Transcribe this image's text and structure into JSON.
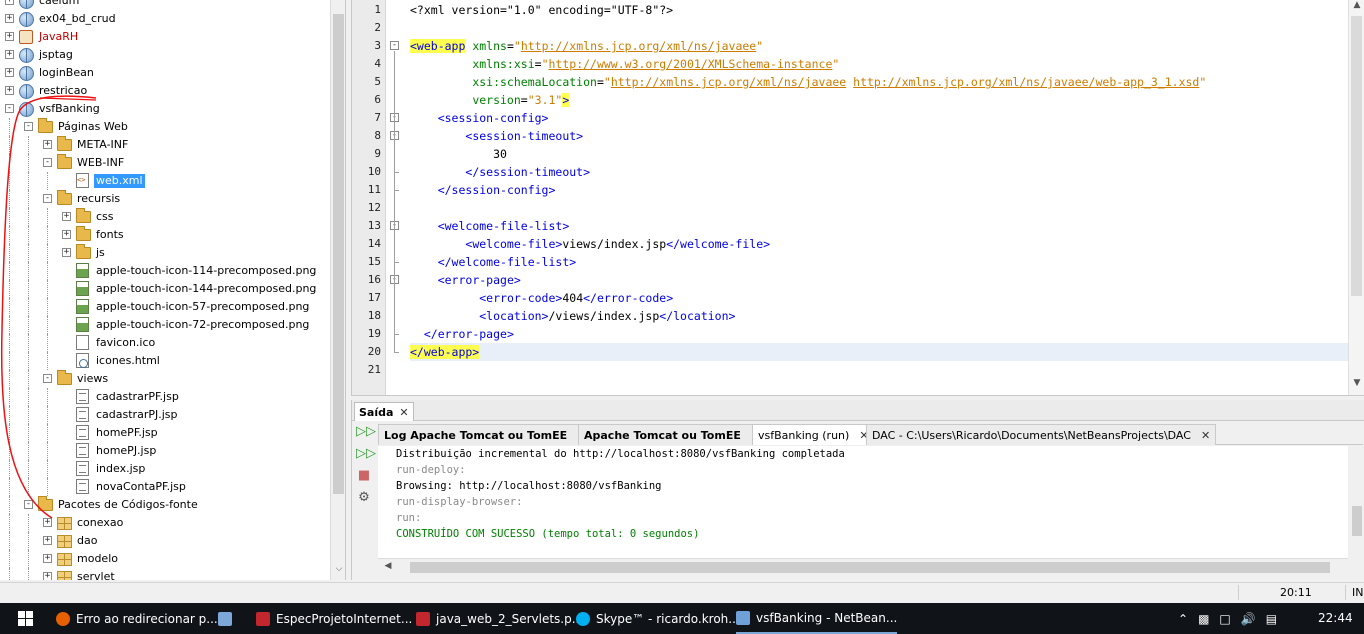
{
  "tree": {
    "items": [
      {
        "label": "caelum",
        "icon": "globe-icon",
        "depth": 0,
        "toggle": "+",
        "style": ""
      },
      {
        "label": "ex04_bd_crud",
        "icon": "globe-icon",
        "depth": 0,
        "toggle": "+",
        "style": ""
      },
      {
        "label": "JavaRH",
        "icon": "java-project-icon",
        "depth": 0,
        "toggle": "+",
        "style": "red"
      },
      {
        "label": "jsptag",
        "icon": "globe-icon",
        "depth": 0,
        "toggle": "+",
        "style": ""
      },
      {
        "label": "loginBean",
        "icon": "globe-icon",
        "depth": 0,
        "toggle": "+",
        "style": ""
      },
      {
        "label": "restricao",
        "icon": "globe-icon",
        "depth": 0,
        "toggle": "+",
        "style": ""
      },
      {
        "label": "vsfBanking",
        "icon": "globe-icon",
        "depth": 0,
        "toggle": "-",
        "style": ""
      },
      {
        "label": "Páginas Web",
        "icon": "folder-icon",
        "depth": 1,
        "toggle": "-",
        "style": ""
      },
      {
        "label": "META-INF",
        "icon": "folder-icon",
        "depth": 2,
        "toggle": "+",
        "style": ""
      },
      {
        "label": "WEB-INF",
        "icon": "folder-icon",
        "depth": 2,
        "toggle": "-",
        "style": ""
      },
      {
        "label": "web.xml",
        "icon": "xml-file-icon",
        "depth": 3,
        "toggle": "",
        "style": "selected"
      },
      {
        "label": "recursis",
        "icon": "folder-icon",
        "depth": 2,
        "toggle": "-",
        "style": ""
      },
      {
        "label": "css",
        "icon": "folder-icon",
        "depth": 3,
        "toggle": "+",
        "style": ""
      },
      {
        "label": "fonts",
        "icon": "folder-icon",
        "depth": 3,
        "toggle": "+",
        "style": ""
      },
      {
        "label": "js",
        "icon": "folder-icon",
        "depth": 3,
        "toggle": "+",
        "style": ""
      },
      {
        "label": "apple-touch-icon-114-precomposed.png",
        "icon": "png-file-icon",
        "depth": 3,
        "toggle": "",
        "style": ""
      },
      {
        "label": "apple-touch-icon-144-precomposed.png",
        "icon": "png-file-icon",
        "depth": 3,
        "toggle": "",
        "style": ""
      },
      {
        "label": "apple-touch-icon-57-precomposed.png",
        "icon": "png-file-icon",
        "depth": 3,
        "toggle": "",
        "style": ""
      },
      {
        "label": "apple-touch-icon-72-precomposed.png",
        "icon": "png-file-icon",
        "depth": 3,
        "toggle": "",
        "style": ""
      },
      {
        "label": "favicon.ico",
        "icon": "ico-file-icon",
        "depth": 3,
        "toggle": "",
        "style": ""
      },
      {
        "label": "icones.html",
        "icon": "html-file-icon",
        "depth": 3,
        "toggle": "",
        "style": ""
      },
      {
        "label": "views",
        "icon": "folder-icon",
        "depth": 2,
        "toggle": "-",
        "style": ""
      },
      {
        "label": "cadastrarPF.jsp",
        "icon": "jsp-file-icon",
        "depth": 3,
        "toggle": "",
        "style": ""
      },
      {
        "label": "cadastrarPJ.jsp",
        "icon": "jsp-file-icon",
        "depth": 3,
        "toggle": "",
        "style": ""
      },
      {
        "label": "homePF.jsp",
        "icon": "jsp-file-icon",
        "depth": 3,
        "toggle": "",
        "style": ""
      },
      {
        "label": "homePJ.jsp",
        "icon": "jsp-file-icon",
        "depth": 3,
        "toggle": "",
        "style": ""
      },
      {
        "label": "index.jsp",
        "icon": "jsp-file-icon",
        "depth": 3,
        "toggle": "",
        "style": ""
      },
      {
        "label": "novaContaPF.jsp",
        "icon": "jsp-file-icon",
        "depth": 3,
        "toggle": "",
        "style": ""
      },
      {
        "label": "Pacotes de Códigos-fonte",
        "icon": "folder-icon",
        "depth": 1,
        "toggle": "-",
        "style": ""
      },
      {
        "label": "conexao",
        "icon": "package-icon",
        "depth": 2,
        "toggle": "+",
        "style": ""
      },
      {
        "label": "dao",
        "icon": "package-icon",
        "depth": 2,
        "toggle": "+",
        "style": ""
      },
      {
        "label": "modelo",
        "icon": "package-icon",
        "depth": 2,
        "toggle": "+",
        "style": ""
      },
      {
        "label": "servlet",
        "icon": "package-icon",
        "depth": 2,
        "toggle": "+",
        "style": ""
      }
    ]
  },
  "editor": {
    "lines": [
      {
        "n": "1",
        "fold": "",
        "tokens": [
          [
            "decl",
            "<?xml version=\"1.0\" encoding=\"UTF-8\"?>"
          ]
        ]
      },
      {
        "n": "2",
        "fold": "",
        "tokens": []
      },
      {
        "n": "3",
        "fold": "-",
        "tokens": [
          [
            "tag-hl",
            "<web-app"
          ],
          [
            "text",
            " "
          ],
          [
            "attr",
            "xmlns"
          ],
          [
            "text",
            "="
          ],
          [
            "val",
            "\""
          ],
          [
            "url",
            "http://xmlns.jcp.org/xml/ns/javaee"
          ],
          [
            "val",
            "\""
          ]
        ]
      },
      {
        "n": "4",
        "fold": "",
        "tokens": [
          [
            "text",
            "         "
          ],
          [
            "attr",
            "xmlns:xsi"
          ],
          [
            "text",
            "="
          ],
          [
            "val",
            "\""
          ],
          [
            "url",
            "http://www.w3.org/2001/XMLSchema-instance"
          ],
          [
            "val",
            "\""
          ]
        ]
      },
      {
        "n": "5",
        "fold": "",
        "tokens": [
          [
            "text",
            "         "
          ],
          [
            "attr",
            "xsi:schemaLocation"
          ],
          [
            "text",
            "="
          ],
          [
            "val",
            "\""
          ],
          [
            "url",
            "http://xmlns.jcp.org/xml/ns/javaee"
          ],
          [
            "val",
            " "
          ],
          [
            "url",
            "http://xmlns.jcp.org/xml/ns/javaee/web-app_3_1.xsd"
          ],
          [
            "val",
            "\""
          ]
        ]
      },
      {
        "n": "6",
        "fold": "",
        "tokens": [
          [
            "text",
            "         "
          ],
          [
            "attr",
            "version"
          ],
          [
            "text",
            "="
          ],
          [
            "val",
            "\"3.1\""
          ],
          [
            "tag-hl",
            ">"
          ]
        ]
      },
      {
        "n": "7",
        "fold": "-",
        "tokens": [
          [
            "text",
            "    "
          ],
          [
            "tag",
            "<session-config>"
          ]
        ]
      },
      {
        "n": "8",
        "fold": "-",
        "tokens": [
          [
            "text",
            "        "
          ],
          [
            "tag",
            "<session-timeout>"
          ]
        ]
      },
      {
        "n": "9",
        "fold": "",
        "tokens": [
          [
            "text",
            "            30"
          ]
        ]
      },
      {
        "n": "10",
        "fold": "",
        "tokens": [
          [
            "text",
            "        "
          ],
          [
            "tag",
            "</session-timeout>"
          ]
        ]
      },
      {
        "n": "11",
        "fold": "",
        "tokens": [
          [
            "text",
            "    "
          ],
          [
            "tag",
            "</session-config>"
          ]
        ]
      },
      {
        "n": "12",
        "fold": "",
        "tokens": []
      },
      {
        "n": "13",
        "fold": "-",
        "tokens": [
          [
            "text",
            "    "
          ],
          [
            "tag",
            "<welcome-file-list>"
          ]
        ]
      },
      {
        "n": "14",
        "fold": "",
        "tokens": [
          [
            "text",
            "        "
          ],
          [
            "tag",
            "<welcome-file>"
          ],
          [
            "text",
            "views/index.jsp"
          ],
          [
            "tag",
            "</welcome-file>"
          ]
        ]
      },
      {
        "n": "15",
        "fold": "",
        "tokens": [
          [
            "text",
            "    "
          ],
          [
            "tag",
            "</welcome-file-list>"
          ]
        ]
      },
      {
        "n": "16",
        "fold": "-",
        "tokens": [
          [
            "text",
            "    "
          ],
          [
            "tag",
            "<error-page>"
          ]
        ]
      },
      {
        "n": "17",
        "fold": "",
        "tokens": [
          [
            "text",
            "          "
          ],
          [
            "tag",
            "<error-code>"
          ],
          [
            "text",
            "404"
          ],
          [
            "tag",
            "</error-code>"
          ]
        ]
      },
      {
        "n": "18",
        "fold": "",
        "tokens": [
          [
            "text",
            "          "
          ],
          [
            "tag",
            "<location>"
          ],
          [
            "text",
            "/views/index.jsp"
          ],
          [
            "tag",
            "</location>"
          ]
        ]
      },
      {
        "n": "19",
        "fold": "",
        "tokens": [
          [
            "text",
            "  "
          ],
          [
            "tag",
            "</error-page>"
          ]
        ]
      },
      {
        "n": "20",
        "fold": "",
        "tokens": [
          [
            "tag-hl",
            "</web-app>"
          ]
        ]
      },
      {
        "n": "21",
        "fold": "",
        "tokens": []
      }
    ]
  },
  "output": {
    "title": "Saída",
    "tabs": [
      {
        "label": "Log Apache Tomcat ou TomEE",
        "bold": true,
        "active": false
      },
      {
        "label": "Apache Tomcat ou TomEE",
        "bold": true,
        "active": false
      },
      {
        "label": "vsfBanking (run)",
        "bold": false,
        "active": true
      },
      {
        "label": "DAC - C:\\Users\\Ricardo\\Documents\\NetBeansProjects\\DAC",
        "bold": false,
        "active": false
      }
    ],
    "lines": [
      {
        "text": "Distribuição incremental do http://localhost:8080/vsfBanking completada",
        "style": "black"
      },
      {
        "text": "run-deploy:",
        "style": "gray"
      },
      {
        "text": "Browsing: http://localhost:8080/vsfBanking",
        "style": "black"
      },
      {
        "text": "run-display-browser:",
        "style": "gray"
      },
      {
        "text": "run:",
        "style": "gray"
      },
      {
        "text": "CONSTRUÍDO COM SUCESSO (tempo total: 0 segundos)",
        "style": "green"
      }
    ]
  },
  "status": {
    "position": "20:11",
    "mode": "INS"
  },
  "taskbar": {
    "items": [
      {
        "label": "Erro ao redirecionar p...",
        "icon": "firefox-icon",
        "color": "#e66000"
      },
      {
        "label": "",
        "icon": "notepad-icon",
        "color": "#7da7d9"
      },
      {
        "label": "EspecProjetoInternet...",
        "icon": "pdf-icon",
        "color": "#c1272d"
      },
      {
        "label": "java_web_2_Servlets.p...",
        "icon": "pdf-icon",
        "color": "#c1272d"
      },
      {
        "label": "Skype™ - ricardo.kroh...",
        "icon": "skype-icon",
        "color": "#00aff0"
      },
      {
        "label": "vsfBanking - NetBean...",
        "icon": "netbeans-icon",
        "color": "#6fa0d8"
      }
    ],
    "clock": "22:44"
  }
}
